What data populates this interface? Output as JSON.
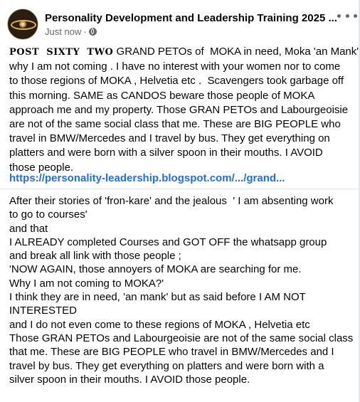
{
  "post": {
    "page_name": "Personality Development and Leadership Training 2025 ...",
    "timestamp": "Just now",
    "separator": "·",
    "privacy_icon": "globe-icon",
    "more_icon": "more-options-icon"
  },
  "text1": {
    "lead": "POST  SIXTY  TWO",
    "lines_first": " GRAND PETOs of  MOKA in need, Moka 'an Mank' ;",
    "lines": [
      "why I am not coming . I have no interest with your women nor to come",
      "to those regions of MOKA , Helvetia etc .  Scavengers took garbage off",
      "this morning. SAME as CANDOS beware those people of MOKA",
      "approach me and my property. Those GRAN PETOs and Labourgeoisie",
      "are not of the same social class that me. These are BIG PEOPLE who",
      "travel in BMW/Mercedes and I travel by bus. They get everything on",
      "platters and were born with a silver spoon in their mouths. I AVOID",
      "those people."
    ]
  },
  "link": {
    "text": "https://personality-leadership.blogspot.com/.../grand..."
  },
  "text2": {
    "lines": [
      "After their stories of 'fron-kare' and the jealous  ' I am absenting work",
      "to go to courses'",
      "and that",
      "I ALREADY completed Courses and GOT OFF the whatsapp group",
      "and break all link with those people ;",
      "'NOW AGAIN, those annoyers of MOKA are searching for me.",
      "Why I am not coming to MOKA?'",
      "I think they are in need, 'an mank' but as said before I AM NOT",
      "INTERESTED",
      "and I do not even come to these regions of MOKA , Helvetia etc",
      "Those GRAN PETOs and Labourgeoisie are not of the same social class",
      "that me. These are BIG PEOPLE who travel in BMW/Mercedes and I",
      "travel by bus. They get everything on platters and were born with a",
      "silver spoon in their mouths. I AVOID those people."
    ]
  }
}
